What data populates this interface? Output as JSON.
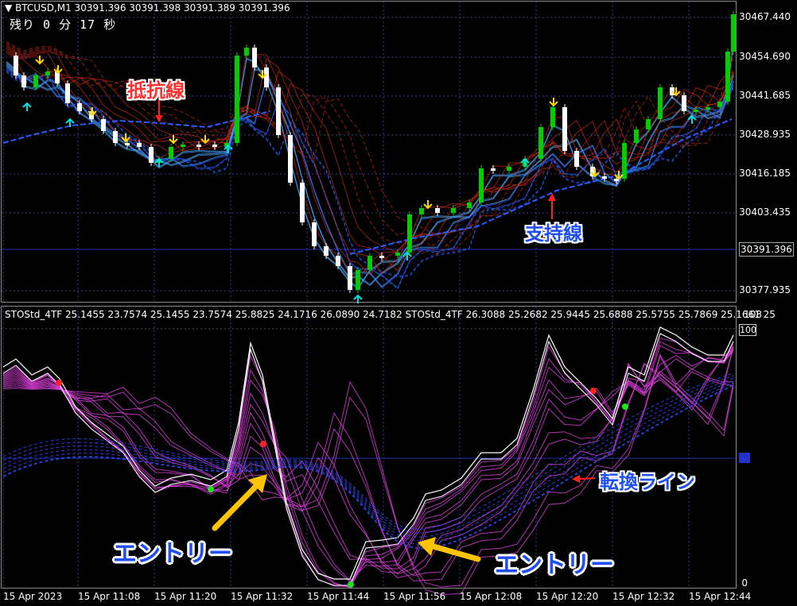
{
  "chart": {
    "symbol_header": "BTCUSD,M1  30391.396 30391.398 30391.389 30391.396",
    "countdown": "残り 0 分 17 秒",
    "current_price_label": "30391.396",
    "price_axis_labels": [
      "30467.440",
      "30454.690",
      "30441.685",
      "30428.935",
      "30416.185",
      "30403.435",
      "30377.935"
    ],
    "indicator_header": "STOStd_4TF 25.1455 23.7574 25.1455 23.7574 25.8825 24.1716 26.0890 24.7182  STOStd_4TF 26.3088 25.2682 25.9445 25.6888 25.5755 25.7869 25.1661 25",
    "indicator_axis_labels": {
      "top": "108",
      "box": "100",
      "bottom": "0"
    },
    "time_axis_labels": [
      "15 Apr 2023",
      "15 Apr 11:08",
      "15 Apr 11:20",
      "15 Apr 11:32",
      "15 Apr 11:44",
      "15 Apr 11:56",
      "15 Apr 12:08",
      "15 Apr 12:20",
      "15 Apr 12:32",
      "15 Apr 12:44"
    ]
  },
  "annotations": {
    "resistance": "抵抗線",
    "support": "支持線",
    "conversion_line": "転換ライン",
    "entry_left": "エントリー",
    "entry_right": "エントリー"
  },
  "colors": {
    "bull_candle": "#00cc00",
    "bear_candle": "#ffffff",
    "resistance_ribbon": "#cc2a10",
    "support_ribbon": "#2a60ff",
    "stoch_ribbon": "#e040e0",
    "stoch_base": "#3050ff",
    "buy_arrow": "#00e0e0",
    "sell_arrow": "#ffd800",
    "annotation_arrow": "#ffcc00"
  }
}
